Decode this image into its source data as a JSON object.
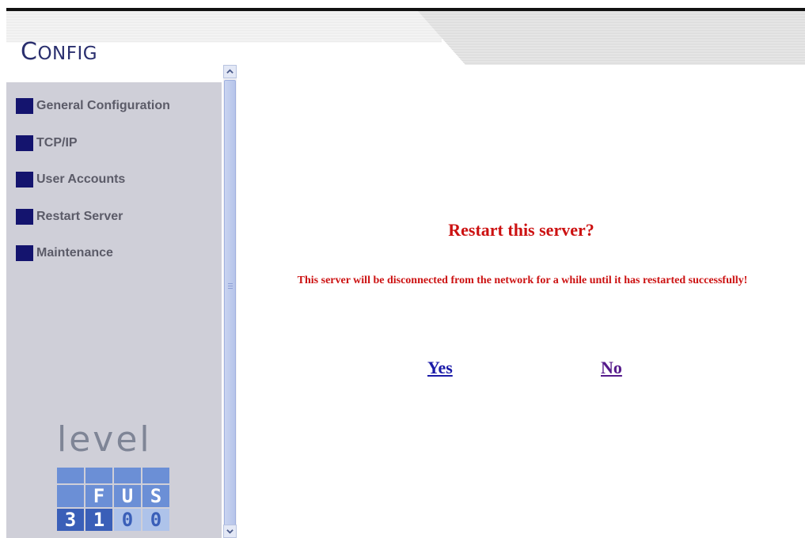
{
  "header": {
    "app_title_first": "C",
    "app_title_rest": "ONFIG"
  },
  "sidebar": {
    "items": [
      {
        "label": "General Configuration"
      },
      {
        "label": "TCP/IP"
      },
      {
        "label": "User Accounts"
      },
      {
        "label": "Restart Server"
      },
      {
        "label": "Maintenance"
      }
    ],
    "logo": {
      "word": "level",
      "row2": [
        "F",
        "U",
        "S"
      ],
      "row3": [
        "3",
        "1",
        "0",
        "0"
      ]
    }
  },
  "dialog": {
    "title": "Restart this server?",
    "message": "This server will be disconnected from the network for a while until it has restarted successfully!",
    "yes_label": "Yes",
    "no_label": "No"
  },
  "colors": {
    "accent_red": "#cc1111",
    "nav_square": "#14146e",
    "sidebar_bg": "#cfcfd8",
    "link_blue": "#1a1aa8",
    "link_visited": "#551a8b"
  }
}
